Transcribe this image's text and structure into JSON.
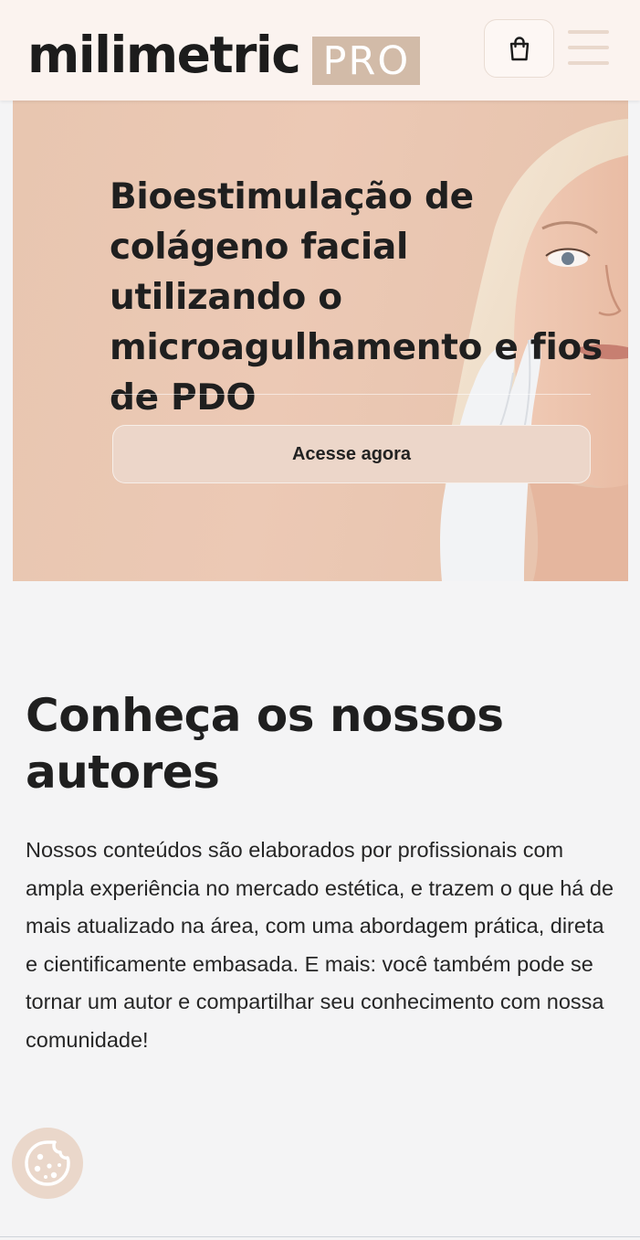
{
  "header": {
    "logo_word": "milimetric",
    "logo_badge": "PRO",
    "cart_icon": "shopping-bag-icon",
    "menu_icon": "hamburger-menu-icon"
  },
  "hero": {
    "title": "Bioestimulação de colágeno facial utilizando o microagulhamento e fios de PDO",
    "cta_label": "Acesse agora"
  },
  "authors": {
    "title": "Conheça os nossos autores",
    "description": "Nossos conteúdos são elaborados por profissionais com ampla experiência no mercado estética, e trazem o que há de mais atualizado na área, com uma abordagem prática, direta e cientificamente embasada. E mais: você também pode se tornar um autor e compartilhar seu conhecimento com nossa comunidade!"
  },
  "cookie": {
    "icon": "cookie-icon"
  },
  "colors": {
    "header_bg": "#fbf3ef",
    "brand_badge": "#d2bba8",
    "hero_bg": "#e8c6b0",
    "cta_bg": "#ecd6c9",
    "page_bg": "#f4f4f5"
  }
}
